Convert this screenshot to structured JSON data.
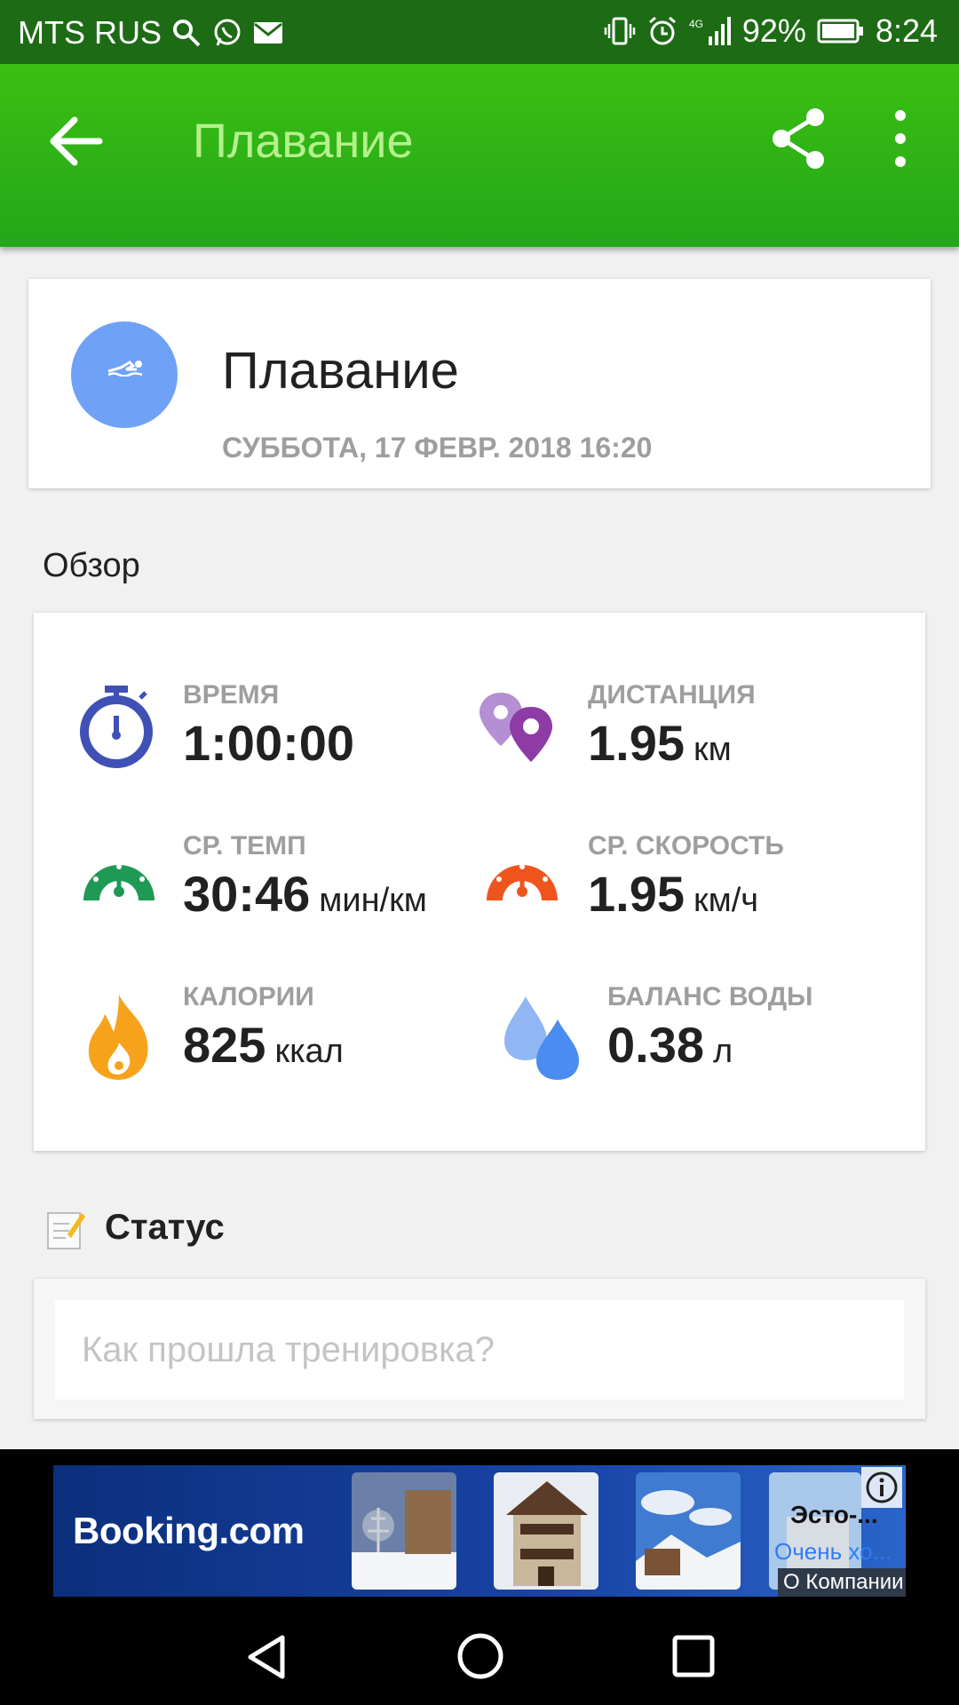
{
  "status_bar": {
    "carrier": "MTS RUS",
    "battery": "92%",
    "time": "8:24",
    "network": "4G",
    "icons": [
      "search-icon",
      "whatsapp-icon",
      "mail-icon",
      "vibrate-icon",
      "alarm-icon",
      "signal-icon",
      "battery-icon"
    ]
  },
  "app_bar": {
    "title": "Плавание",
    "icons": [
      "back-arrow-icon",
      "share-icon",
      "more-vert-icon"
    ]
  },
  "activity": {
    "title": "Плавание",
    "datetime": "СУББОТА, 17 ФЕВР. 2018 16:20",
    "icon": "swimmer-icon"
  },
  "overview": {
    "section_title": "Обзор",
    "stats": [
      {
        "label": "ВРЕМЯ",
        "value": "1:00:00",
        "unit": "",
        "icon": "stopwatch-icon",
        "color": "#3f51b5"
      },
      {
        "label": "ДИСТАНЦИЯ",
        "value": "1.95",
        "unit": "км",
        "icon": "map-pins-icon",
        "color": "#8e3ba6"
      },
      {
        "label": "СР. ТЕМП",
        "value": "30:46",
        "unit": "мин/км",
        "icon": "pace-gauge-icon",
        "color": "#1e9a55"
      },
      {
        "label": "СР. СКОРОСТЬ",
        "value": "1.95",
        "unit": "км/ч",
        "icon": "speed-gauge-icon",
        "color": "#f0541d"
      },
      {
        "label": "КАЛОРИИ",
        "value": "825",
        "unit": "ккал",
        "icon": "flame-icon",
        "color": "#f7a21b"
      },
      {
        "label": "БАЛАНС ВОДЫ",
        "value": "0.38",
        "unit": "л",
        "icon": "water-drops-icon",
        "color": "#4a8cf0"
      }
    ]
  },
  "status": {
    "title": "Статус",
    "placeholder": "Как прошла тренировка?",
    "icon": "note-edit-icon"
  },
  "ad": {
    "brand": "Booking.com",
    "title_text": "Эсто-...",
    "subtitle_text": "Очень хо...",
    "company_text": "О Компании",
    "icon": "info-icon"
  },
  "nav_bar": {
    "icons": [
      "nav-back-icon",
      "nav-home-icon",
      "nav-recents-icon"
    ]
  },
  "colors": {
    "status_bar": "#1d6b15",
    "app_bar": "#2fb516",
    "swim_circle": "#6fa1f7"
  }
}
